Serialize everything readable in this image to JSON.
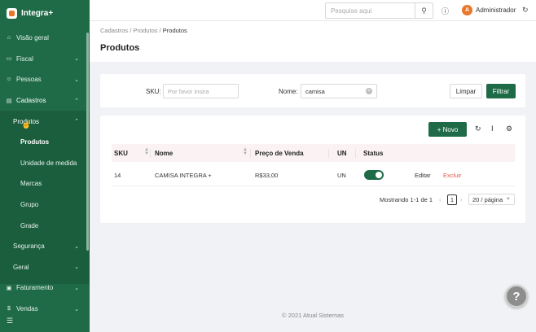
{
  "app": {
    "name": "Integra+"
  },
  "colors": {
    "brand": "#1f6b47",
    "accent": "#e8762d",
    "danger": "#e05a4f"
  },
  "sidebar": {
    "items": [
      {
        "label": "Visão geral",
        "icon": "home-icon"
      },
      {
        "label": "Fiscal",
        "icon": "file-icon",
        "chevron": "⌄"
      },
      {
        "label": "Pessoas",
        "icon": "users-icon",
        "chevron": "⌄"
      },
      {
        "label": "Cadastros",
        "icon": "list-icon",
        "chevron": "⌃"
      },
      {
        "label": "Produtos",
        "chevron": "⌃"
      },
      {
        "label": "Produtos"
      },
      {
        "label": "Unidade de medida"
      },
      {
        "label": "Marcas"
      },
      {
        "label": "Grupo"
      },
      {
        "label": "Grade"
      },
      {
        "label": "Segurança",
        "chevron": "⌄"
      },
      {
        "label": "Geral",
        "chevron": "⌄"
      },
      {
        "label": "Faturamento",
        "icon": "invoice-icon",
        "chevron": "⌄"
      },
      {
        "label": "Vendas",
        "icon": "sales-icon",
        "chevron": "⌄"
      }
    ]
  },
  "header": {
    "search_placeholder": "Pesquise aqui",
    "user_initial": "A",
    "user_name": "Administrador"
  },
  "breadcrumb": {
    "items": [
      "Cadastros",
      "/",
      "Produtos",
      "/",
      "Produtos"
    ]
  },
  "page": {
    "title": "Produtos"
  },
  "filter": {
    "sku_label": "SKU:",
    "sku_placeholder": "Por favor insira",
    "nome_label": "Nome:",
    "nome_value": "camisa",
    "clear_label": "Limpar",
    "filter_label": "Filtrar"
  },
  "table": {
    "new_label": "+ Novo",
    "columns": [
      "SKU",
      "Nome",
      "Preço de Venda",
      "UN",
      "Status"
    ],
    "rows": [
      {
        "sku": "14",
        "nome": "CAMISA INTEGRA +",
        "preco": "R$33,00",
        "un": "UN",
        "status": true,
        "edit": "Editar",
        "delete": "Excluir"
      }
    ]
  },
  "pagination": {
    "summary": "Mostrando 1-1 de 1",
    "page": "1",
    "page_size": "20 / página"
  },
  "footer": {
    "text": "© 2021 Atual Sistemas"
  },
  "help": {
    "label": "?"
  }
}
